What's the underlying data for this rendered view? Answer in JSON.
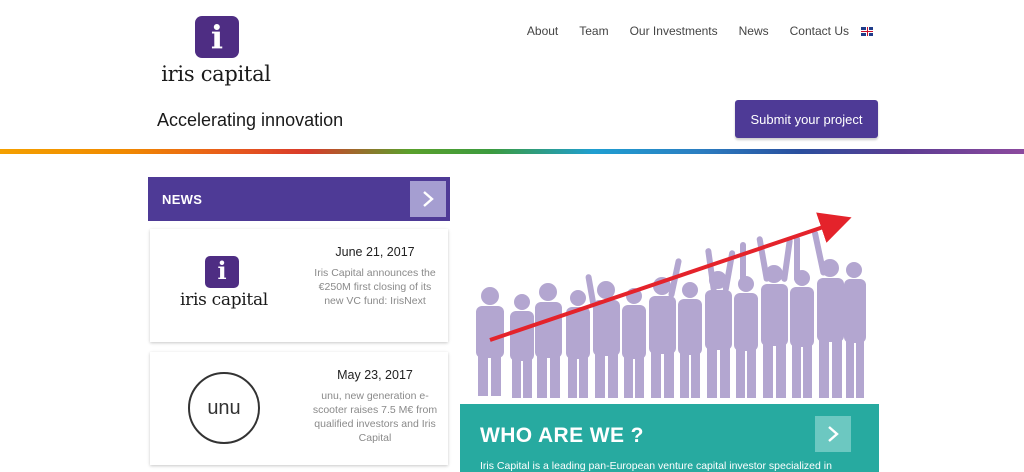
{
  "brand": {
    "logo_glyph": "i",
    "logo_text": "iris capital",
    "logo_color": "#4e2d83"
  },
  "nav": {
    "items": [
      "About",
      "Team",
      "Our Investments",
      "News",
      "Contact Us"
    ],
    "language_icon": "uk-flag-icon"
  },
  "header": {
    "tagline": "Accelerating innovation",
    "submit_label": "Submit your project",
    "accent_color": "#4e3a96"
  },
  "news": {
    "title": "NEWS",
    "items": [
      {
        "date": "June 21, 2017",
        "text": "Iris Capital announces the €250M first closing of its new VC fund: IrisNext",
        "logo_glyph": "i",
        "logo_text": "iris capital"
      },
      {
        "date": "May 23, 2017",
        "text": "unu, new generation e-scooter raises 7.5 M€ from qualified investors and Iris Capital",
        "logo_text": "unu"
      }
    ]
  },
  "who": {
    "title": "WHO ARE WE ?",
    "text": "Iris Capital is a leading pan-European venture capital investor specialized in",
    "color": "#27aaa0"
  }
}
